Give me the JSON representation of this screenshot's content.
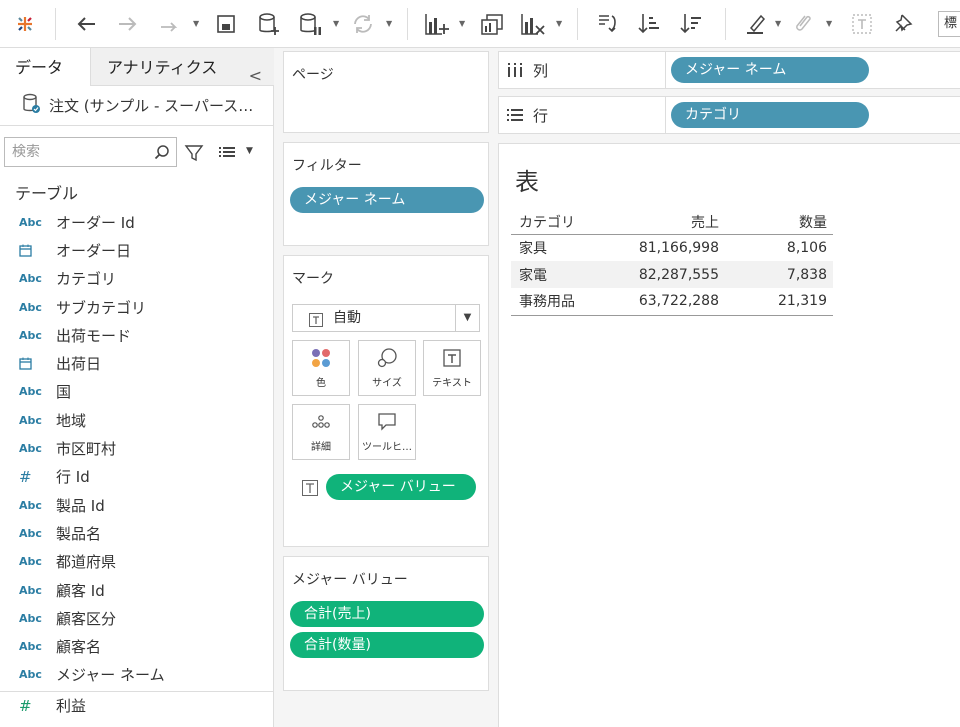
{
  "left_pane": {
    "tabs": [
      "データ",
      "アナリティクス"
    ],
    "collapse_glyph": "<",
    "datasource": "注文 (サンプル - スーパース…",
    "search_placeholder": "検索",
    "tables_header": "テーブル",
    "fields": [
      {
        "type": "Abc",
        "name": "オーダー Id"
      },
      {
        "type": "date",
        "name": "オーダー日"
      },
      {
        "type": "Abc",
        "name": "カテゴリ"
      },
      {
        "type": "Abc",
        "name": "サブカテゴリ"
      },
      {
        "type": "Abc",
        "name": "出荷モード"
      },
      {
        "type": "date",
        "name": "出荷日"
      },
      {
        "type": "Abc",
        "name": "国"
      },
      {
        "type": "Abc",
        "name": "地域"
      },
      {
        "type": "Abc",
        "name": "市区町村"
      },
      {
        "type": "#",
        "name": "行 Id"
      },
      {
        "type": "Abc",
        "name": "製品 Id"
      },
      {
        "type": "Abc",
        "name": "製品名"
      },
      {
        "type": "Abc",
        "name": "都道府県"
      },
      {
        "type": "Abc",
        "name": "顧客 Id"
      },
      {
        "type": "Abc",
        "name": "顧客区分"
      },
      {
        "type": "Abc",
        "name": "顧客名"
      },
      {
        "type": "Abc",
        "name": "メジャー ネーム"
      },
      {
        "type": "measure",
        "name": "利益"
      }
    ]
  },
  "shelves": {
    "pages_title": "ページ",
    "filters_title": "フィルター",
    "filter_pill": "メジャー ネーム",
    "marks_title": "マーク",
    "mark_type": "自動",
    "mark_buttons": [
      "色",
      "サイズ",
      "テキスト",
      "詳細",
      "ツールヒ…"
    ],
    "text_pill": "メジャー バリュー",
    "measure_values_title": "メジャー バリュー",
    "measure_value_pills": [
      "合計(売上)",
      "合計(数量)"
    ],
    "columns_label": "列",
    "columns_pill": "メジャー ネーム",
    "rows_label": "行",
    "rows_pill": "カテゴリ"
  },
  "view": {
    "title": "表",
    "table": {
      "headers": [
        "カテゴリ",
        "売上",
        "数量"
      ],
      "rows": [
        [
          "家具",
          "81,166,998",
          "8,106"
        ],
        [
          "家電",
          "82,287,555",
          "7,838"
        ],
        [
          "事務用品",
          "63,722,288",
          "21,319"
        ]
      ]
    }
  },
  "toolbar": {
    "cut_off_label": "標"
  },
  "colors": {
    "pill_blue": "#4996b2",
    "pill_green": "#10b37a",
    "field_type_blue": "#2b7da3"
  },
  "icons": {
    "toolbar": [
      "tableau-logo-icon",
      "back-icon",
      "forward-icon",
      "redo-icon",
      "save-icon",
      "new-datasource-icon",
      "pause-updates-icon",
      "refresh-icon",
      "new-sheet-icon",
      "duplicate-sheet-icon",
      "clear-sheet-icon",
      "swap-icon",
      "sort-ascending-icon",
      "sort-descending-icon",
      "highlight-icon",
      "group-icon",
      "label-icon",
      "pin-icon"
    ],
    "mark_buttons": [
      "color-icon",
      "size-icon",
      "text-icon",
      "detail-icon",
      "tooltip-icon"
    ]
  }
}
